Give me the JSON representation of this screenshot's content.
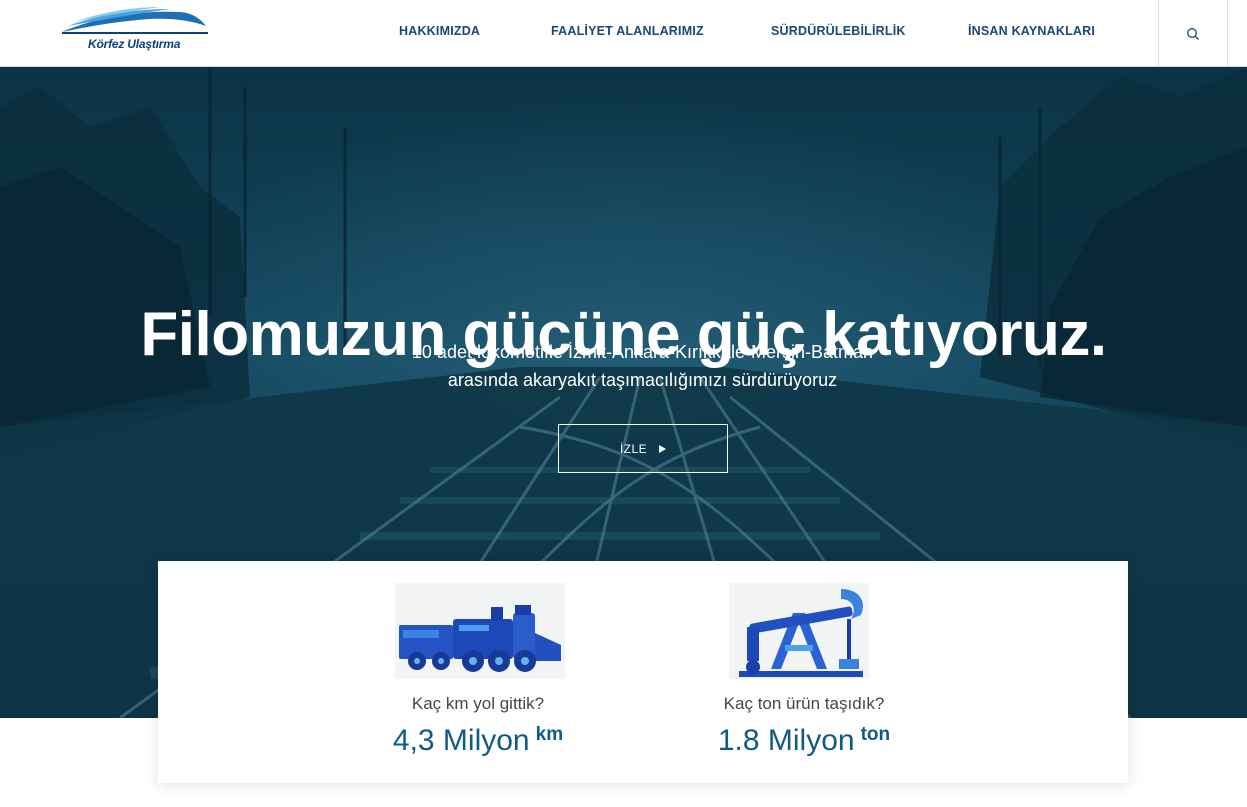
{
  "header": {
    "logo_text": "Körfez Ulaştırma",
    "nav": [
      {
        "label": "HAKKIMIZDA"
      },
      {
        "label": "FAALİYET ALANLARIMIZ"
      },
      {
        "label": "SÜRDÜRÜLEBİLİRLİK"
      },
      {
        "label": "İNSAN KAYNAKLARI"
      }
    ],
    "search_icon": "search-icon"
  },
  "hero": {
    "title": "Filomuzun gücüne güç katıyoruz.",
    "subtitle_line1": "10 adet lokomotifle İzmit-Ankara-Kırıkkale-Mersin-Batman",
    "subtitle_line2": "arasında akaryakıt taşımacılığımızı sürdürüyoruz",
    "button_label": "İZLE",
    "button_icon": "play-icon"
  },
  "stats": [
    {
      "icon": "locomotive-icon",
      "question": "Kaç km yol gittik?",
      "value": "4,3 Milyon",
      "unit": "km"
    },
    {
      "icon": "oil-pump-icon",
      "question": "Kaç ton ürün taşıdık?",
      "value": "1.8 Milyon",
      "unit": "ton"
    }
  ],
  "colors": {
    "brand_blue": "#1c4775",
    "stat_blue": "#105a86",
    "hero_tint": "#0e3c52"
  }
}
